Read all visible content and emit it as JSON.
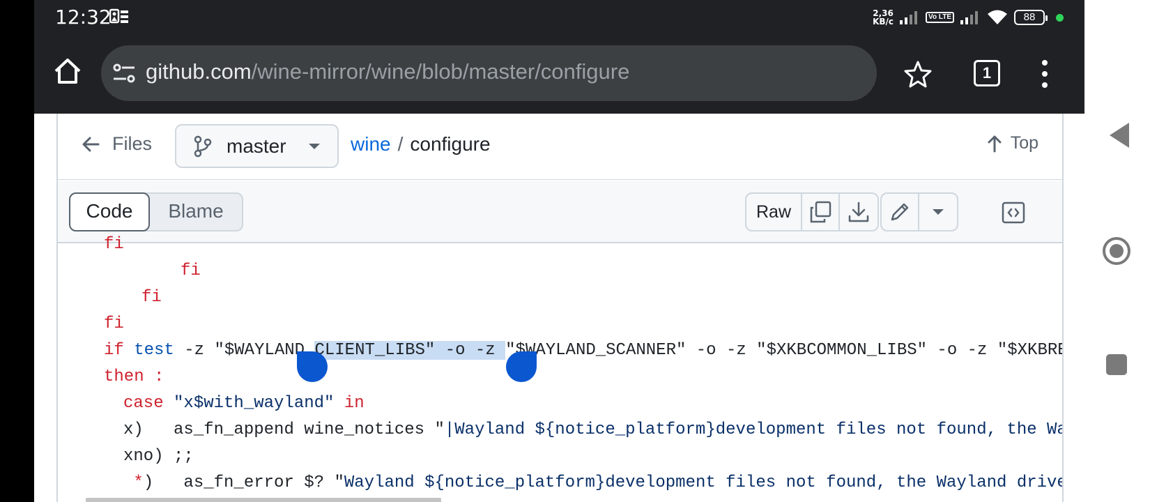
{
  "status_bar": {
    "time": "12:32",
    "net_speed_value": "2,36",
    "net_speed_unit": "KB/с",
    "volte_label": "Vo LTE",
    "battery": "88"
  },
  "browser": {
    "url_domain": "github.com",
    "url_path": "/wine-mirror/wine/blob/master/configure",
    "tab_count": "1"
  },
  "file_header": {
    "back_label": "Files",
    "branch": "master",
    "repo": "wine",
    "separator": "/",
    "file": "configure",
    "top_label": "Top"
  },
  "toolbar": {
    "code_tab": "Code",
    "blame_tab": "Blame",
    "raw_label": "Raw"
  },
  "code": {
    "line0": "fi",
    "line1": "fi",
    "line2": "fi",
    "line3_kw": "if",
    "line3_fn": "test",
    "line3_a": " -z \"$WAYLAND_",
    "line3_sel": "CLIENT_LIBS\" -o -z ",
    "line3_b": "\"$WAYLAND_SCANNER\" -o -z \"$XKBCOMMON_LIBS\" -o -z \"$XKBREGISTRY_LIBS\"",
    "line4_kw": "then :",
    "line5_kw": "case",
    "line5_str": "\"x$with_wayland\"",
    "line5_in": "in",
    "line6_a": "x)   as_fn_append wine_notices \"",
    "line6_b": "|Wayland ${notice_platform}",
    "line6_c": "development files not found, the Wayland driver won't be supported.\"",
    "line7": "xno) ;;",
    "line8_star": "*",
    "line8_a": ")   as_fn_error $? \"",
    "line8_b": "Wayland ${notice_platform}",
    "line8_c": "development files not found, the Wayland driver won't be supported."
  },
  "colors": {
    "accent_link": "#0969da",
    "selection_handle": "#0b57d0",
    "keyword": "#cf222e",
    "string": "#0a3069",
    "browser_bar": "#202124"
  }
}
